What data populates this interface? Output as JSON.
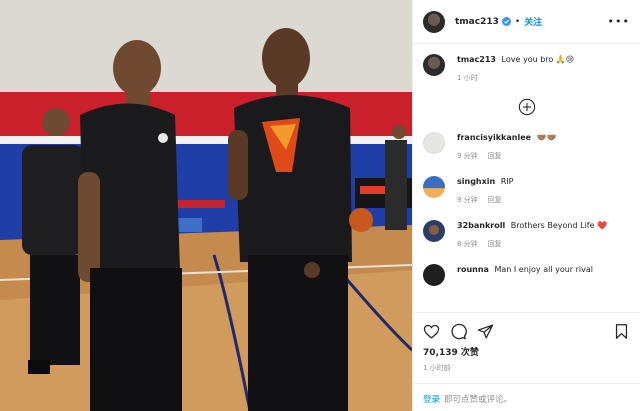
{
  "post": {
    "username": "tmac213",
    "follow_label": "关注",
    "more_icon": "more-options-icon"
  },
  "caption": {
    "username": "tmac213",
    "text": "Love you bro 🙏😢",
    "time": "1 小时"
  },
  "comments": [
    {
      "username": "francisyikkanlee",
      "text": "🤝🏽🤝🏽",
      "time": "9 分钟",
      "reply": "回复"
    },
    {
      "username": "singhxin",
      "text": "RIP",
      "time": "9 分钟",
      "reply": "回复"
    },
    {
      "username": "32bankroll",
      "text": "Brothers Beyond Life ❤️",
      "time": "8 分钟",
      "reply": "回复"
    },
    {
      "username": "rounna",
      "text": "Man I enjoy all your rival",
      "time": "",
      "reply": ""
    }
  ],
  "likes": {
    "count": "70,139",
    "label": "次赞"
  },
  "timestamp": "1 小时前",
  "login": {
    "link": "登录",
    "text": "即可点赞或评论。"
  },
  "colors": {
    "link_blue": "#0095f6",
    "muted_gray": "#8e8e8e",
    "border": "#efefef"
  }
}
